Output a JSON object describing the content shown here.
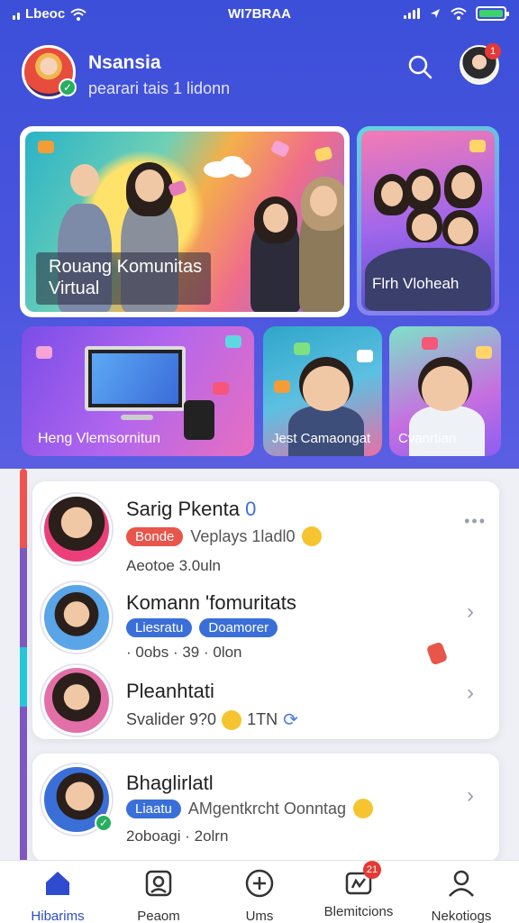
{
  "status_bar": {
    "carrier": "Lbeoc",
    "title": "WI7BRAA"
  },
  "header": {
    "user_name": "Nsansia",
    "user_subtitle": "pearari tais 1 lidonn",
    "notification_count": "1"
  },
  "banners": [
    {
      "label_line1": "Rouang Komunitas",
      "label_line2": "Virtual"
    },
    {
      "label": "Flrh Vloheah"
    },
    {
      "label": "Heng Vlemsornitun"
    },
    {
      "label": "Jest Camaongat"
    },
    {
      "label": "Cvanrtian"
    }
  ],
  "list": [
    {
      "title": "Sarig Pkenta",
      "title_badge": "0",
      "chip": "Bonde",
      "chip_color": "#e8554a",
      "meta_text": "Veplays 1ladl0",
      "footer": "Aeotoe  3.0uln"
    },
    {
      "title": "Komann 'fomuritats",
      "chip": "Liesratu",
      "chip_color": "#3a6fd8",
      "chip2": "Doamorer",
      "chip2_color": "#3a6fd8",
      "footer": "· 0obs   ·  39        · 0lon"
    },
    {
      "title": "Pleanhtati",
      "footer": "Svalider  9?0",
      "footer2": "1TN"
    },
    {
      "title": "Bhaglirlatl",
      "chip": "Liaatu",
      "chip_color": "#3a6fd8",
      "meta_text": "AMgentkrcht  Oonntag",
      "footer": "2oboagi  ·  2olrn"
    }
  ],
  "nav": [
    {
      "label": "Hibarims",
      "active": true
    },
    {
      "label": "Peaom"
    },
    {
      "label": "Ums"
    },
    {
      "label": "Blemitcions",
      "badge": "21"
    },
    {
      "label": "Nekotiogs"
    }
  ],
  "colors": {
    "header_bg": "#3c4fd8",
    "accent": "#2f4bd0",
    "danger": "#e53935",
    "success": "#27ae60"
  }
}
